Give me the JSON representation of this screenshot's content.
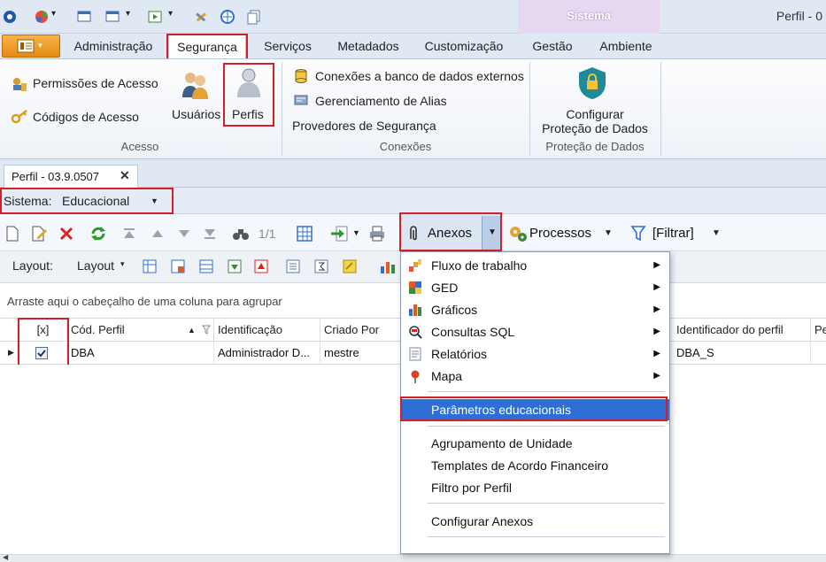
{
  "window": {
    "title": "Perfil - 0",
    "context_tab": "Sistema"
  },
  "ribbon_tabs": [
    "Administração",
    "Segurança",
    "Serviços",
    "Metadados",
    "Customização",
    "Gestão",
    "Ambiente"
  ],
  "ribbon": {
    "acesso": {
      "permissoes": "Permissões de Acesso",
      "codigos": "Códigos de Acesso",
      "usuarios": "Usuários",
      "perfis": "Perfis",
      "group_label": "Acesso"
    },
    "conexoes": {
      "bd_externos": "Conexões a banco de dados externos",
      "alias": "Gerenciamento de Alias",
      "provedores": "Provedores de Segurança",
      "group_label": "Conexões"
    },
    "protecao": {
      "configurar_line1": "Configurar",
      "configurar_line2": "Proteção de Dados",
      "group_label": "Proteção de Dados"
    }
  },
  "doc_tab": {
    "label": "Perfil - 03.9.0507",
    "close": "✕"
  },
  "sistema": {
    "label": "Sistema:",
    "value": "Educacional",
    "arrow": "▼"
  },
  "toolbar": {
    "record_nav": "1/1",
    "anexos": "Anexos",
    "processos": "Processos",
    "filtrar": "[Filtrar]"
  },
  "toolbar2": {
    "layout_label": "Layout:",
    "layout_dropdown": "Layout"
  },
  "groupbar_text": "Arraste aqui o cabeçalho de uma coluna para agrupar",
  "grid": {
    "columns": [
      "[x]",
      "Cód. Perfil",
      "Identificação",
      "Criado Por",
      "Identificador do perfil",
      "Pe"
    ],
    "row": {
      "cod": "DBA",
      "identificacao": "Administrador D...",
      "criado_por": "mestre",
      "identificador": "DBA_S"
    }
  },
  "menu": {
    "items_with_sub": [
      "Fluxo de trabalho",
      "GED",
      "Gráficos",
      "Consultas SQL",
      "Relatórios",
      "Mapa"
    ],
    "highlighted": "Parâmetros educacionais",
    "group2": [
      "Agrupamento de Unidade",
      "Templates de Acordo Financeiro",
      "Filtro por Perfil"
    ],
    "configurar": "Configurar Anexos"
  },
  "colors": {
    "highlight_red": "#d21f2a",
    "menu_highlight": "#2e6fd6",
    "ribbon_bg": "#dfe8f3",
    "context_purple": "#e7d8f2"
  }
}
